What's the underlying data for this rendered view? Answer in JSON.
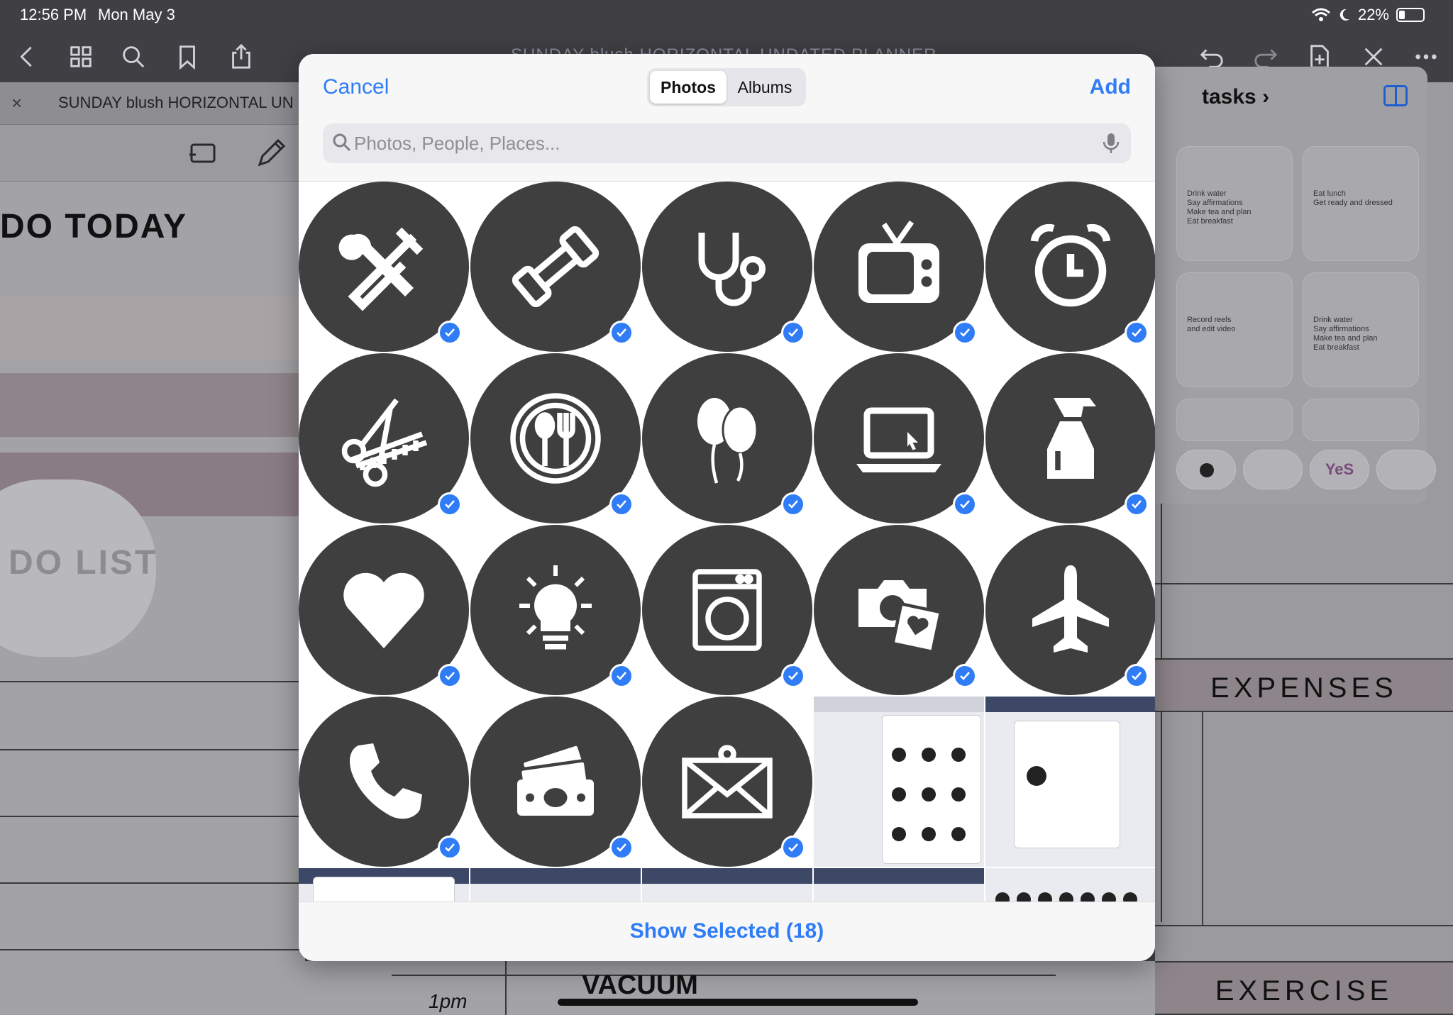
{
  "status_bar": {
    "time": "12:56 PM",
    "date": "Mon May 3",
    "battery": "22%"
  },
  "toolbar": {
    "doc_title": "SUNDAY blush HORIZONTAL UNDATED PLANNER"
  },
  "tab": {
    "close": "×",
    "title": "SUNDAY blush HORIZONTAL UN"
  },
  "planner_left": {
    "heading": "DO TODAY",
    "list_heading": "DO LIST"
  },
  "sidebar": {
    "title": "tasks ›",
    "cards": [
      {
        "lines": [
          "Drink water",
          "Say affirmations",
          "Make tea and plan",
          "Eat breakfast"
        ]
      },
      {
        "lines": [
          "Eat lunch",
          "Get ready and dressed"
        ]
      },
      {
        "lines": [
          "Record reels",
          "and edit video"
        ]
      },
      {
        "lines": [
          "Drink water",
          "Say affirmations",
          "Make tea and plan",
          "Eat breakfast"
        ]
      }
    ],
    "chip_label": "YeS"
  },
  "planner_right": {
    "expenses": "EXPENSES",
    "exercise": "EXERCISE"
  },
  "planner_bottom": {
    "time_label": "1pm",
    "sticker_text": "VACUUM"
  },
  "picker": {
    "cancel": "Cancel",
    "add": "Add",
    "segments": [
      "Photos",
      "Albums"
    ],
    "active_segment": "Photos",
    "search_placeholder": "Photos, People, Places...",
    "show_selected": "Show Selected (18)",
    "accent_color": "#2f7cf6",
    "icons": [
      "tools-icon",
      "dumbbell-icon",
      "stethoscope-icon",
      "tv-icon",
      "alarm-clock-icon",
      "scissors-comb-icon",
      "plate-cutlery-icon",
      "balloons-icon",
      "laptop-icon",
      "spray-bottle-icon",
      "heart-icon",
      "lightbulb-icon",
      "washing-machine-icon",
      "camera-photo-icon",
      "airplane-icon",
      "phone-icon",
      "money-icon",
      "envelope-icon"
    ]
  }
}
